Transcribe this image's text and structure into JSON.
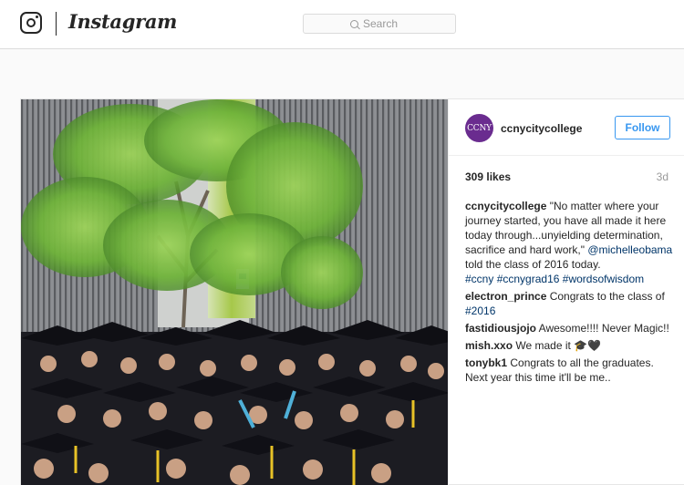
{
  "nav": {
    "brand": "Instagram",
    "search_placeholder": "Search"
  },
  "post": {
    "account": "ccnycitycollege",
    "avatar_text": "CCNY",
    "follow_label": "Follow",
    "likes": "309 likes",
    "age": "3d",
    "caption": {
      "author": "ccnycitycollege",
      "text_1": "\"No matter where your journey started, you have all made it here today through...unyielding determination, sacrifice and hard work,\"",
      "mention": "@michelleobama",
      "text_2": "told the class of 2016 today.",
      "hashtags": [
        "#ccny",
        "#ccnygrad16",
        "#wordsofwisdom"
      ]
    },
    "comments": [
      {
        "author": "electron_prince",
        "text": "Congrats to the class of",
        "tag": "#2016"
      },
      {
        "author": "fastidiousjojo",
        "text": "Awesome!!!! Never Magic!!"
      },
      {
        "author": "mish.xxo",
        "text": "We made it 🎓🖤"
      },
      {
        "author": "tonybk1",
        "text": "Congrats to all the graduates. Next year this time it'll be me.."
      }
    ]
  },
  "colors": {
    "accent": "#3897f0",
    "link": "#003569",
    "avatar_bg": "#6a2c8f",
    "border": "#dbdbdb"
  }
}
